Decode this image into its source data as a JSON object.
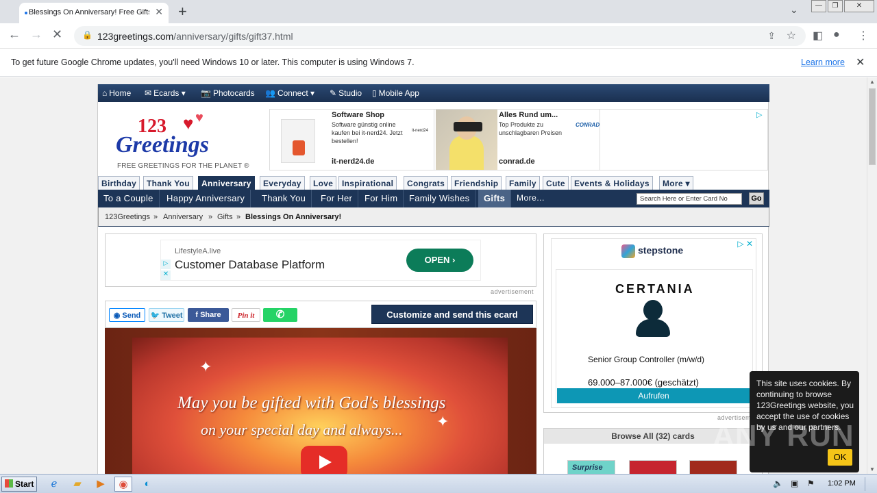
{
  "browser": {
    "tab_title": "Blessings On Anniversary! Free Gifts",
    "url_domain": "123greetings.com",
    "url_path": "/anniversary/gifts/gift37.html",
    "infobar_message": "To get future Google Chrome updates, you'll need Windows 10 or later. This computer is using Windows 7.",
    "infobar_link": "Learn more"
  },
  "site": {
    "topnav": [
      "Home",
      "Ecards",
      "Photocards",
      "Connect",
      "Studio",
      "Mobile App"
    ],
    "logo": {
      "number": "123",
      "word": "Greetings",
      "tagline": "FREE GREETINGS FOR THE PLANET ®"
    },
    "header_ads": [
      {
        "title": "Software Shop",
        "text": "Software günstig online kaufen bei it-nerd24. Jetzt bestellen!",
        "domain": "it-nerd24.de",
        "brand": "it-nerd24"
      },
      {
        "title": "Alles Rund um...",
        "text": "Top Produkte zu unschlagbaren Preisen",
        "domain": "conrad.de",
        "brand": "CONRAD"
      }
    ],
    "category_tabs": [
      "Birthday",
      "Thank You",
      "Anniversary",
      "Everyday",
      "Love",
      "Inspirational",
      "Congrats",
      "Friendship",
      "Family",
      "Cute",
      "Events & Holidays",
      "More"
    ],
    "active_category": "Anniversary",
    "subnav": [
      "To a Couple",
      "Happy Anniversary",
      "Thank You",
      "For Her",
      "For Him",
      "Family Wishes",
      "Gifts"
    ],
    "active_subnav": "Gifts",
    "subnav_more": "More...",
    "search_placeholder": "Search Here or Enter Card No",
    "go_label": "Go",
    "breadcrumb": [
      "123Greetings",
      "Anniversary",
      "Gifts",
      "Blessings On Anniversary!"
    ]
  },
  "main": {
    "top_ad": {
      "advertiser": "LifestyleA.live",
      "headline": "Customer Database Platform",
      "cta": "OPEN",
      "label": "advertisement"
    },
    "share": {
      "send": "Send",
      "tweet": "Tweet",
      "share": "Share",
      "pin": "Pin it"
    },
    "customize_label": "Customize and send this ecard",
    "ecard": {
      "line1": "May you be gifted with God's blessings",
      "line2": "on your special day and always..."
    }
  },
  "sidebar": {
    "ad": {
      "brand": "stepstone",
      "company": "CERTANIA",
      "job": "Senior Group Controller (m/w/d)",
      "salary": "69.000–87.000€ (geschätzt)",
      "cta": "Aufrufen",
      "label": "advertisement"
    },
    "browse_all": "Browse All (32) cards",
    "thumb_label": "Surprise"
  },
  "cookie": {
    "text": "This site uses cookies. By continuing to browse 123Greetings website, you accept the use of cookies by us and our partners.",
    "ok": "OK"
  },
  "taskbar": {
    "start": "Start",
    "time": "1:02 PM"
  },
  "watermark": "ANY RUN"
}
